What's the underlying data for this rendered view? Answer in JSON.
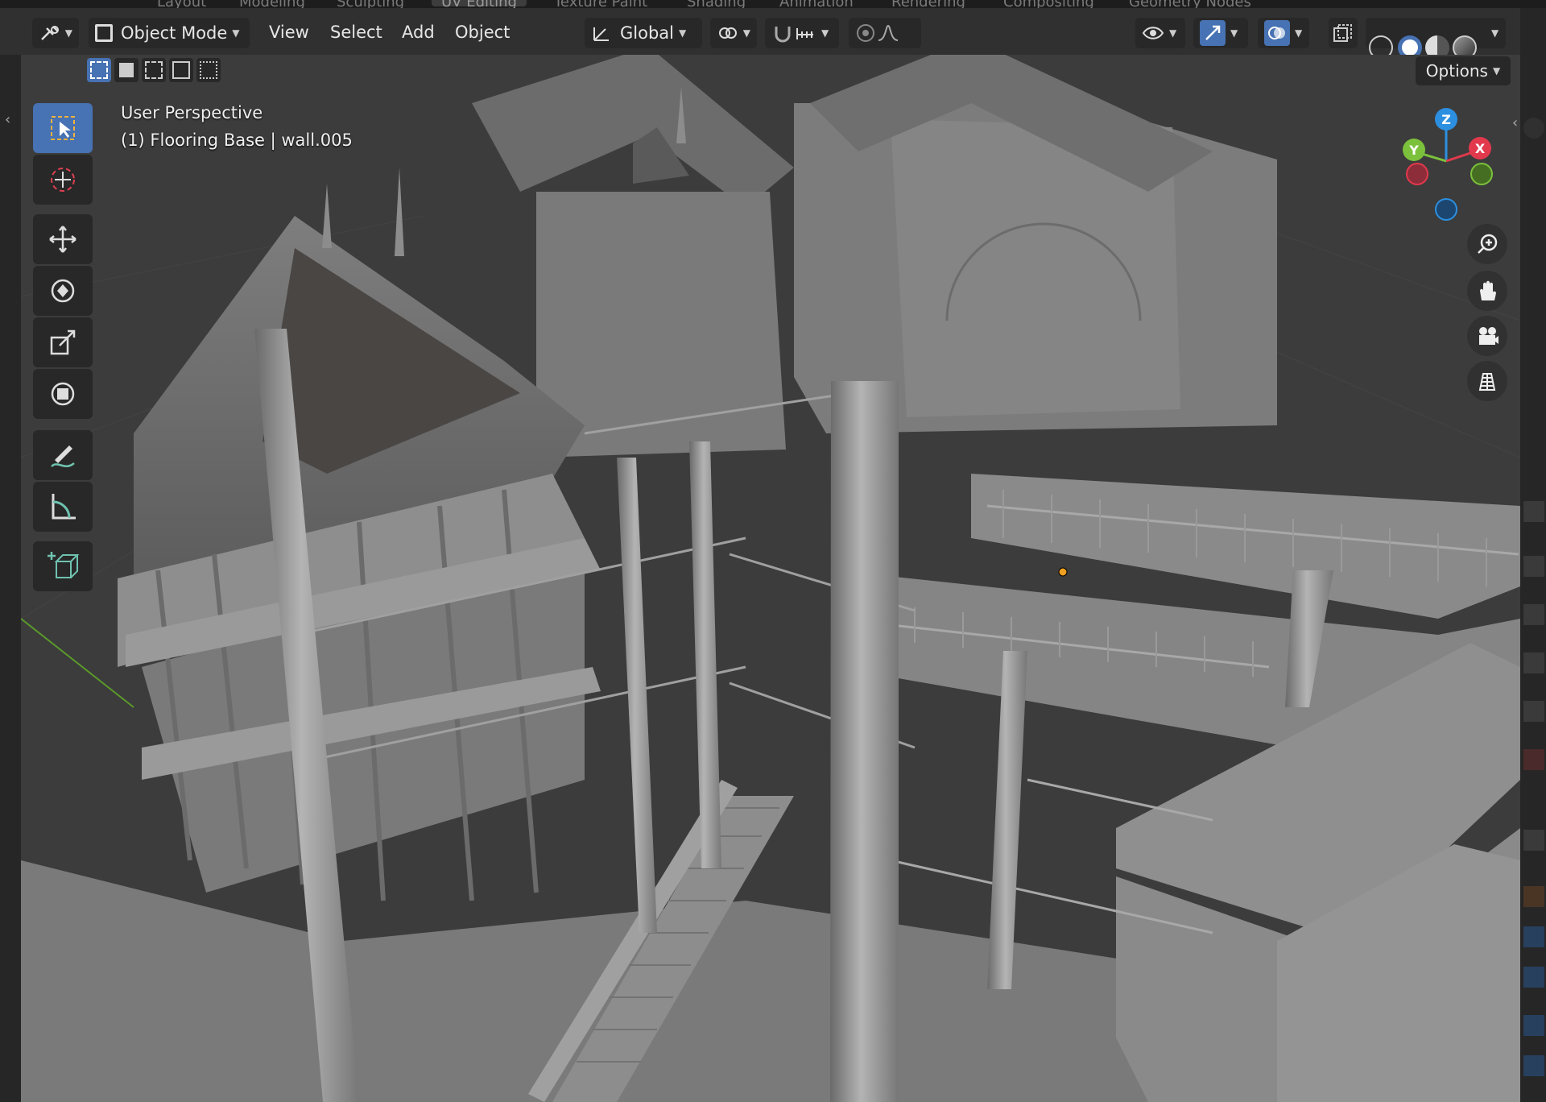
{
  "workspace_tabs": [
    "Layout",
    "Modeling",
    "Sculpting",
    "UV Editing",
    "Texture Paint",
    "Shading",
    "Animation",
    "Rendering",
    "Compositing",
    "Geometry Nodes"
  ],
  "header": {
    "mode_label": "Object Mode",
    "menus": [
      "View",
      "Select",
      "Add",
      "Object"
    ],
    "orientation_label": "Global",
    "options_label": "Options"
  },
  "viewport": {
    "view_name": "User Perspective",
    "object_info": "(1) Flooring Base | wall.005"
  },
  "gizmo": {
    "x": "X",
    "y": "Y",
    "z": "Z"
  },
  "colors": {
    "accent": "#4772b3",
    "axis_x": "#e2394d",
    "axis_y": "#7cc13c",
    "axis_z": "#2c8fe0"
  },
  "tools": [
    "select-box",
    "cursor",
    "move",
    "rotate",
    "scale",
    "transform",
    "annotate",
    "measure",
    "add-cube"
  ]
}
